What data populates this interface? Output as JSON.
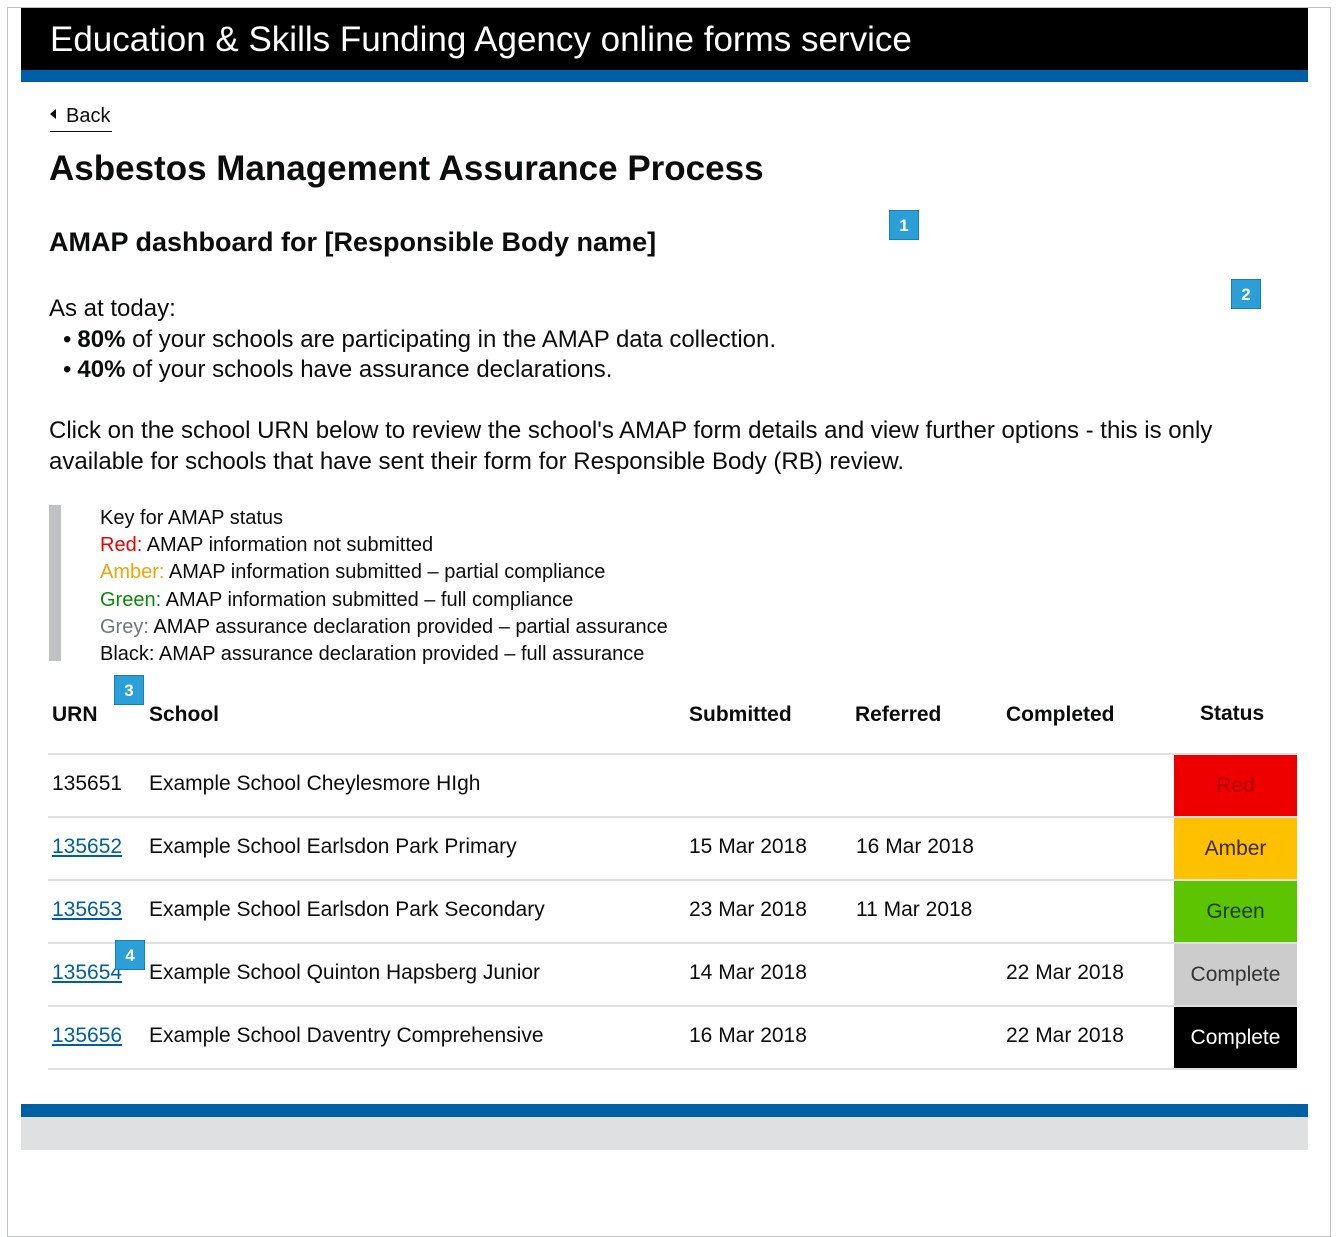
{
  "header": {
    "title": "Education & Skills Funding Agency online forms service"
  },
  "back_link": {
    "label": "Back"
  },
  "page": {
    "title": "Asbestos Management Assurance Process",
    "dashboard_title": "AMAP dashboard for [Responsible Body name]"
  },
  "markers": [
    "1",
    "2",
    "3",
    "4"
  ],
  "summary": {
    "intro": "As at today:",
    "items": [
      {
        "value": "80%",
        "text": " of your schools are participating in the AMAP data collection."
      },
      {
        "value": "40%",
        "text": " of your schools have assurance declarations."
      }
    ]
  },
  "instructions": "Click on the school URN below to review the school's AMAP form details and view further options - this is only available for schools that have sent their form for Responsible Body (RB) review.",
  "key": {
    "heading": "Key for AMAP status",
    "items": [
      {
        "label": "Red:",
        "text": " AMAP information not submitted",
        "color": "#ee0000"
      },
      {
        "label": "Amber:",
        "text": " AMAP information submitted – partial compliance",
        "color": "#f0a30a"
      },
      {
        "label": "Green:",
        "text": " AMAP information submitted – full compliance",
        "color": "#0a8a0a"
      },
      {
        "label": "Grey:",
        "text": " AMAP assurance declaration provided – partial assurance",
        "color": "#6f777b"
      },
      {
        "label": "Black:",
        "text": " AMAP assurance declaration provided – full assurance",
        "color": "#0b0c0c"
      }
    ]
  },
  "table": {
    "headers": {
      "urn": "URN",
      "school": "School",
      "submitted": "Submitted",
      "referred": "Referred",
      "completed": "Completed",
      "status": "Status"
    },
    "rows": [
      {
        "urn": "135651",
        "school": "Example School Cheylesmore HIgh",
        "submitted": "",
        "referred": "",
        "completed": "",
        "status": "Red",
        "status_bg": "#ee0000",
        "status_fg": "#b30000",
        "link": false
      },
      {
        "urn": "135652",
        "school": "Example School Earlsdon Park Primary",
        "submitted": "15 Mar 2018",
        "referred": "16 Mar 2018",
        "completed": "",
        "status": "Amber",
        "status_bg": "#ffc000",
        "status_fg": "#3a2a00",
        "link": true
      },
      {
        "urn": "135653",
        "school": "Example School Earlsdon Park Secondary",
        "submitted": "23 Mar 2018",
        "referred": "11 Mar 2018",
        "completed": "",
        "status": "Green",
        "status_bg": "#5cc400",
        "status_fg": "#1b3d00",
        "link": true
      },
      {
        "urn": "135654",
        "school": "Example School Quinton Hapsberg Junior",
        "submitted": "14 Mar 2018",
        "referred": "",
        "completed": "22 Mar 2018",
        "status": "Complete",
        "status_bg": "#cccccc",
        "status_fg": "#333333",
        "link": true
      },
      {
        "urn": "135656",
        "school": "Example School Daventry Comprehensive",
        "submitted": "16 Mar 2018",
        "referred": "",
        "completed": "22 Mar 2018",
        "status": "Complete",
        "status_bg": "#000000",
        "status_fg": "#ffffff",
        "link": true
      }
    ]
  }
}
